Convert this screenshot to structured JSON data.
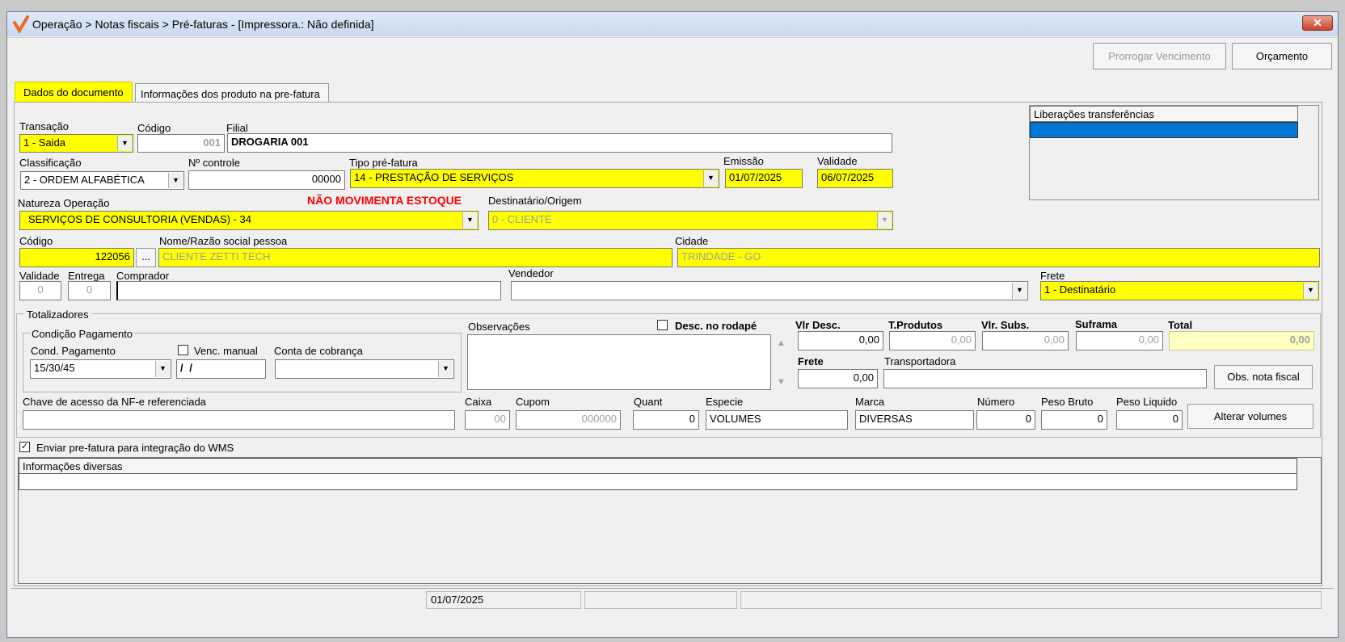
{
  "window": {
    "title": "Operação > Notas fiscais > Pré-faturas - [Impressora.: Não definida]",
    "close_label": "✕"
  },
  "toolbar": {
    "prorrogar_label": "Prorrogar Vencimento",
    "orcamento_label": "Orçamento"
  },
  "tabs": [
    {
      "label": "Dados do documento"
    },
    {
      "label": "Informações dos produto na pre-fatura"
    }
  ],
  "doc": {
    "transacao_label": "Transação",
    "transacao_value": "1 - Saida",
    "codigo_label": "Código",
    "codigo_value": "001",
    "filial_label": "Filial",
    "filial_value": "DROGARIA 001",
    "classificacao_label": "Classificação",
    "classificacao_value": "2 - ORDEM ALFABÉTICA",
    "ncontrole_label": "Nº controle",
    "ncontrole_value": "00000",
    "tipo_label": "Tipo pré-fatura",
    "tipo_value": "14 - PRESTAÇÃO DE SERVIÇOS",
    "emissao_label": "Emissão",
    "emissao_value": "01/07/2025",
    "validade_label": "Validade",
    "validade_value": "06/07/2025",
    "natureza_label": "Natureza  Operação",
    "natureza_value": "SERVIÇOS DE CONSULTORIA (VENDAS) - 34",
    "nao_movimenta": "NÃO MOVIMENTA ESTOQUE",
    "destinatario_label": "Destinatário/Origem",
    "destinatario_value": "0 - CLIENTE",
    "pessoa_codigo_label": "Código",
    "pessoa_codigo_value": "122056",
    "ellipsis": "...",
    "nome_label": "Nome/Razão social pessoa",
    "nome_value": "CLIENTE ZETTI TECH",
    "cidade_label": "Cidade",
    "cidade_value": "TRINDADE - GO",
    "validade2_label": "Validade",
    "validade2_value": "0",
    "entrega_label": "Entrega",
    "entrega_value": "0",
    "comprador_label": "Comprador",
    "comprador_value": "",
    "vendedor_label": "Vendedor",
    "vendedor_value": "",
    "frete_label": "Frete",
    "frete_value": "1 - Destinatário"
  },
  "liberacoes": {
    "header": "Liberações transferências"
  },
  "totalizadores": {
    "title": "Totalizadores",
    "condicao_title": "Condição Pagamento",
    "cond_label": "Cond. Pagamento",
    "cond_value": "15/30/45",
    "venc_manual_label": "Venc. manual",
    "venc_manual_value": "/ /",
    "conta_label": "Conta de cobrança",
    "conta_value": "",
    "observacoes_label": "Observações",
    "desc_rodape_label": "Desc. no rodapé",
    "vlr_desc_label": "Vlr Desc.",
    "vlr_desc_value": "0,00",
    "tprodutos_label": "T.Produtos",
    "tprodutos_value": "0,00",
    "vlr_subs_label": "Vlr. Subs.",
    "vlr_subs_value": "0,00",
    "suframa_label": "Suframa",
    "suframa_value": "0,00",
    "total_label": "Total",
    "total_value": "0,00",
    "frete_label": "Frete",
    "frete_value": "0,00",
    "transportadora_label": "Transportadora",
    "transportadora_value": "",
    "obs_nota_label": "Obs. nota fiscal",
    "chave_label": "Chave de acesso da NF-e referenciada",
    "chave_value": "",
    "caixa_label": "Caixa",
    "caixa_value": "00",
    "cupom_label": "Cupom",
    "cupom_value": "000000",
    "quant_label": "Quant",
    "quant_value": "0",
    "especie_label": "Especie",
    "especie_value": "VOLUMES",
    "marca_label": "Marca",
    "marca_value": "DIVERSAS",
    "numero_label": "Número",
    "numero_value": "0",
    "peso_bruto_label": "Peso Bruto",
    "peso_bruto_value": "0",
    "peso_liquido_label": "Peso Liquido",
    "peso_liquido_value": "0",
    "alterar_volumes_label": "Alterar volumes"
  },
  "wms": {
    "label": "Enviar pre-fatura para integração do WMS",
    "checked": true
  },
  "info_diversas": {
    "header": "Informações diversas"
  },
  "status": {
    "date": "01/07/2025"
  },
  "icons": {
    "app_logo": "checkmark-logo-icon",
    "dropdown": "chevron-down-icon",
    "scroll_up": "scroll-up-icon",
    "scroll_down": "scroll-down-icon"
  },
  "colors": {
    "highlight": "#ffff00",
    "alert_red": "#ff0000",
    "selection_blue": "#0078d7"
  }
}
